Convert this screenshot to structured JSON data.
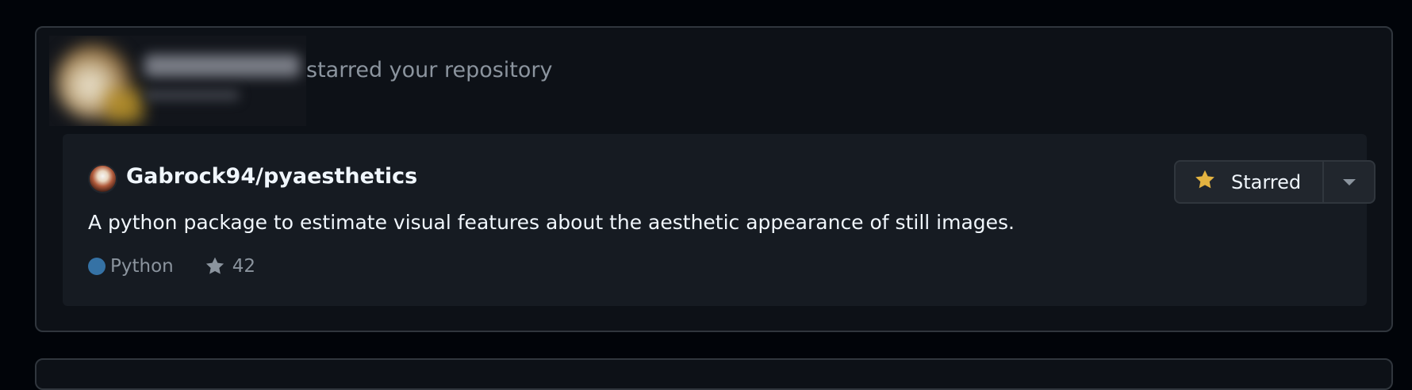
{
  "notification": {
    "action_text": "starred your repository"
  },
  "repo": {
    "full_name": "Gabrock94/pyaesthetics",
    "description": "A python package to estimate visual features about the aesthetic appearance of still images.",
    "language": "Python",
    "language_color": "#3572a5",
    "star_count": "42"
  },
  "star_button": {
    "label": "Starred",
    "icon": "star-filled-icon",
    "accent": "#e3b341"
  },
  "colors": {
    "background": "#010409",
    "card": "#0d1117",
    "repo_card": "#161b22",
    "border": "#30363d",
    "muted_text": "#8b949e"
  }
}
